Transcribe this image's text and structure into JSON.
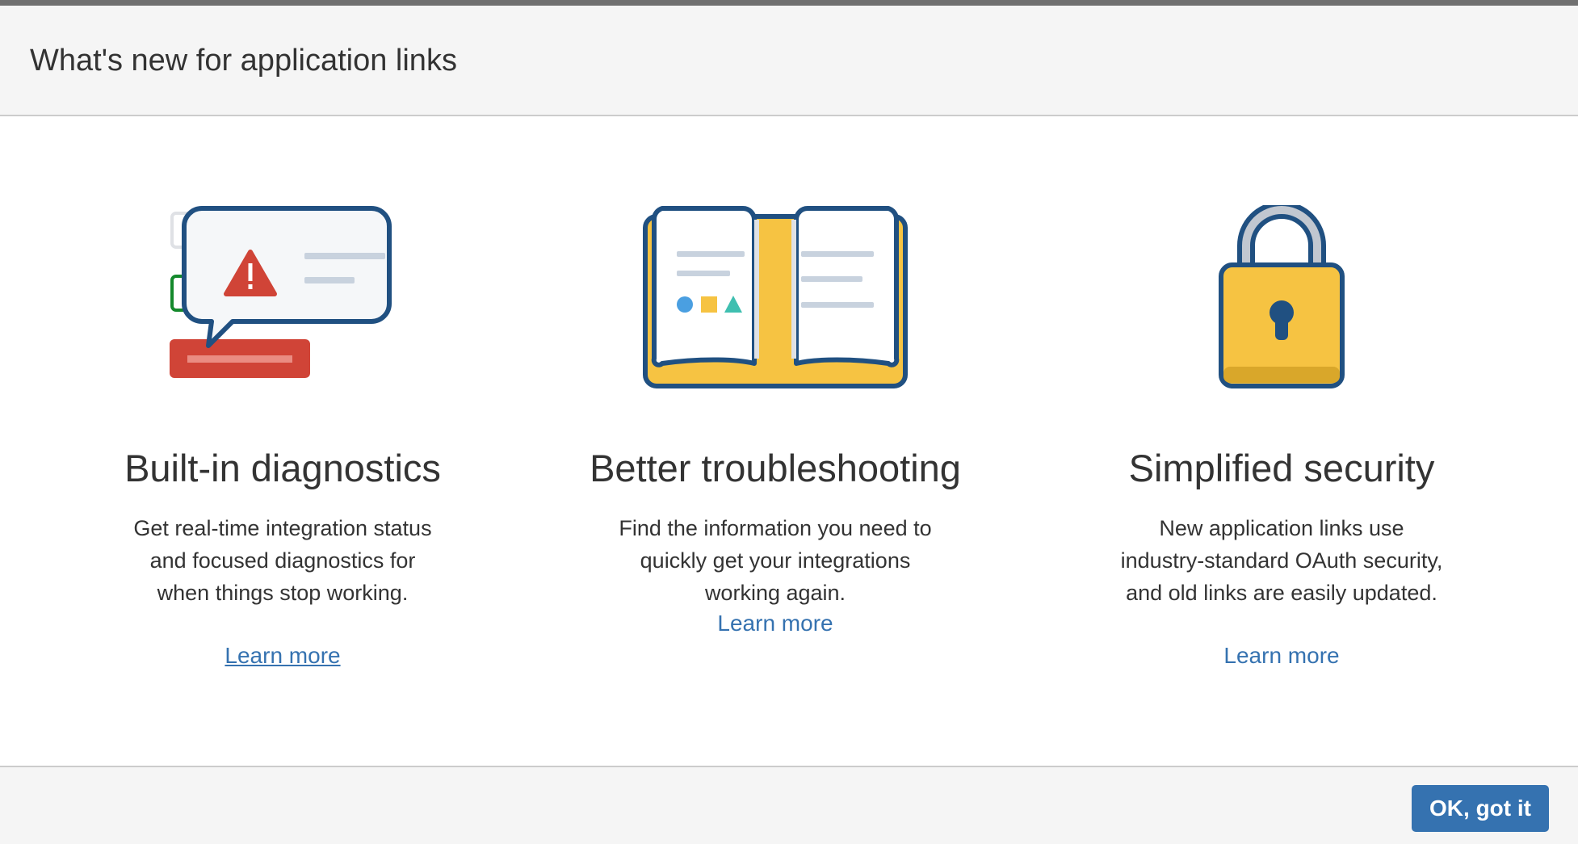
{
  "dialog": {
    "title": "What's new for application links",
    "ok_button_label": "OK, got it"
  },
  "features": [
    {
      "heading": "Built-in diagnostics",
      "description": "Get real-time integration status and focused diagnostics for when things stop working.",
      "link_label": "Learn more",
      "icon": "diagnostics-speech-bubble-warning-icon"
    },
    {
      "heading": "Better troubleshooting",
      "description": "Find the information you need to quickly get your integrations working again.",
      "link_label": "Learn more",
      "icon": "open-book-icon"
    },
    {
      "heading": "Simplified security",
      "description": "New application links use industry-standard OAuth security, and old links are easily updated.",
      "link_label": "Learn more",
      "icon": "padlock-icon"
    }
  ],
  "colors": {
    "link": "#3572b0",
    "primary_button": "#3572b0",
    "icon_outline": "#205081",
    "icon_yellow": "#f6c342",
    "icon_red": "#d04437",
    "icon_green": "#14892c",
    "header_bg": "#f5f5f5"
  }
}
